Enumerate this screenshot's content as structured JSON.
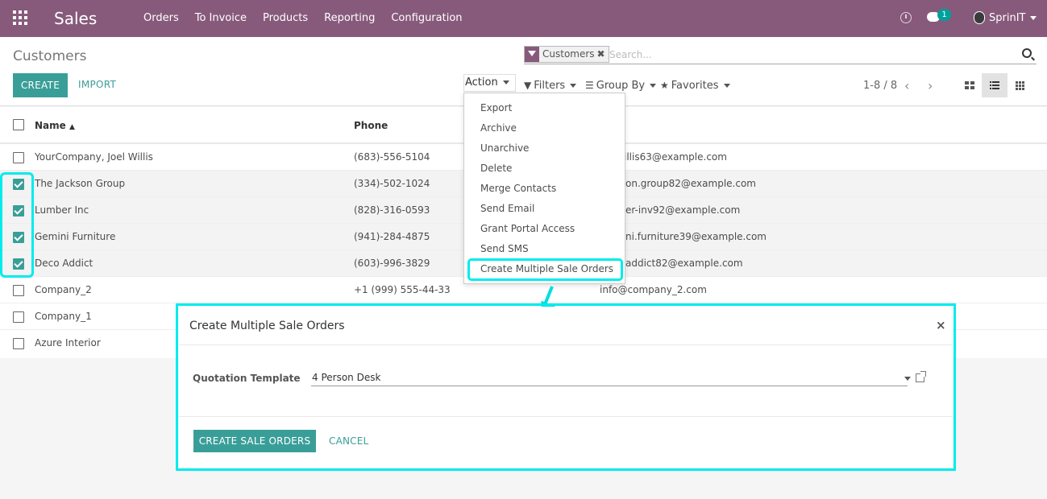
{
  "navbar": {
    "app_name": "Sales",
    "menu": [
      "Orders",
      "To Invoice",
      "Products",
      "Reporting",
      "Configuration"
    ],
    "messages_count": "1",
    "user_name": "SprinIT",
    "icons": [
      "apps-grid-icon",
      "clock-icon",
      "chat-icon",
      "avatar"
    ]
  },
  "control_panel": {
    "breadcrumb": "Customers",
    "create_label": "CREATE",
    "import_label": "IMPORT",
    "search": {
      "facet_label": "Customers",
      "facet_remove": "✖",
      "placeholder": "Search..."
    },
    "action_label": "Action",
    "filters_label": "Filters",
    "groupby_label": "Group By",
    "favorites_label": "Favorites",
    "pager": "1-8 / 8"
  },
  "list": {
    "columns": {
      "name": "Name",
      "phone": "Phone"
    },
    "rows": [
      {
        "name": "YourCompany, Joel Willis",
        "phone": "(683)-556-5104",
        "email": "joel.willis63@example.com",
        "email_visible": "illis63@example.com",
        "checked": false
      },
      {
        "name": "The Jackson Group",
        "phone": "(334)-502-1024",
        "email_visible": "on.group82@example.com",
        "checked": true
      },
      {
        "name": "Lumber Inc",
        "phone": "(828)-316-0593",
        "email_visible": "er-inv92@example.com",
        "checked": true
      },
      {
        "name": "Gemini Furniture",
        "phone": "(941)-284-4875",
        "email_visible": "ni.furniture39@example.com",
        "checked": true
      },
      {
        "name": "Deco Addict",
        "phone": "(603)-996-3829",
        "email_visible": "addict82@example.com",
        "checked": true
      },
      {
        "name": "Company_2",
        "phone": "+1 (999) 555-44-33",
        "email_visible": "info@company_2.com",
        "checked": false
      },
      {
        "name": "Company_1",
        "phone": "",
        "email_visible": "",
        "checked": false
      },
      {
        "name": "Azure Interior",
        "phone": "",
        "email_visible": "",
        "checked": false
      }
    ]
  },
  "action_menu": {
    "items": [
      "Export",
      "Archive",
      "Unarchive",
      "Delete",
      "Merge Contacts",
      "Send Email",
      "Grant Portal Access",
      "Send SMS",
      "Create Multiple Sale Orders"
    ]
  },
  "dialog": {
    "title": "Create Multiple Sale Orders",
    "close": "×",
    "field_label": "Quotation Template",
    "field_value": "4 Person Desk",
    "primary_label": "CREATE SALE ORDERS",
    "cancel_label": "CANCEL"
  },
  "colors": {
    "brand": "#875a7b",
    "accent": "#3a9e98",
    "annotation": "#00ecec"
  }
}
